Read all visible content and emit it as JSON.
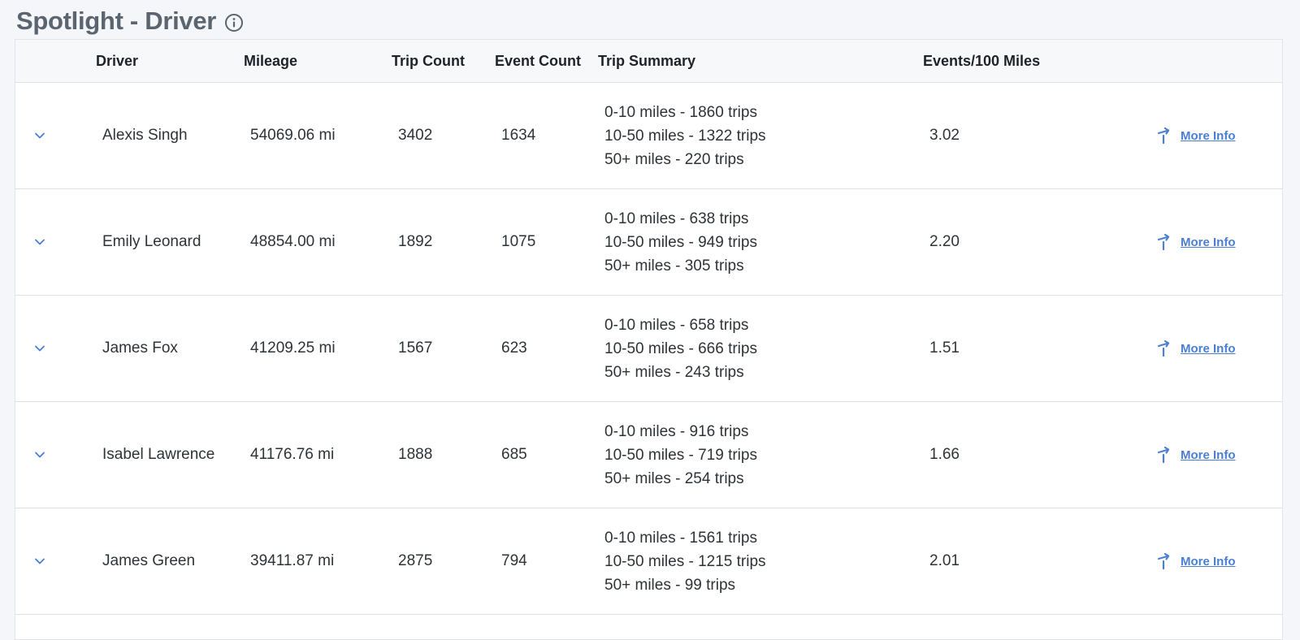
{
  "header": {
    "title": "Spotlight - Driver"
  },
  "table": {
    "columns": [
      "Driver",
      "Mileage",
      "Trip Count",
      "Event Count",
      "Trip Summary",
      "Events/100 Miles"
    ],
    "link_label": "More Info",
    "rows": [
      {
        "driver": "Alexis Singh",
        "mileage": "54069.06 mi",
        "trip_count": "3402",
        "event_count": "1634",
        "summary": [
          "0-10 miles - 1860 trips",
          "10-50 miles - 1322 trips",
          "50+ miles - 220 trips"
        ],
        "events_per_100": "3.02"
      },
      {
        "driver": "Emily Leonard",
        "mileage": "48854.00 mi",
        "trip_count": "1892",
        "event_count": "1075",
        "summary": [
          "0-10 miles - 638 trips",
          "10-50 miles - 949 trips",
          "50+ miles - 305 trips"
        ],
        "events_per_100": "2.20"
      },
      {
        "driver": "James Fox",
        "mileage": "41209.25 mi",
        "trip_count": "1567",
        "event_count": "623",
        "summary": [
          "0-10 miles - 658 trips",
          "10-50 miles - 666 trips",
          "50+ miles - 243 trips"
        ],
        "events_per_100": "1.51"
      },
      {
        "driver": "Isabel Lawrence",
        "mileage": "41176.76 mi",
        "trip_count": "1888",
        "event_count": "685",
        "summary": [
          "0-10 miles - 916 trips",
          "10-50 miles - 719 trips",
          "50+ miles - 254 trips"
        ],
        "events_per_100": "1.66"
      },
      {
        "driver": "James Green",
        "mileage": "39411.87 mi",
        "trip_count": "2875",
        "event_count": "794",
        "summary": [
          "0-10 miles - 1561 trips",
          "10-50 miles - 1215 trips",
          "50+ miles - 99 trips"
        ],
        "events_per_100": "2.01"
      }
    ]
  },
  "colors": {
    "accent": "#4a7fd1",
    "title": "#5b6570",
    "background": "#f4f6f9"
  },
  "icons": {
    "title_info": "info-icon",
    "row_expand": "chevron-down-icon",
    "more_info": "arrow-turn-up-right-icon"
  }
}
